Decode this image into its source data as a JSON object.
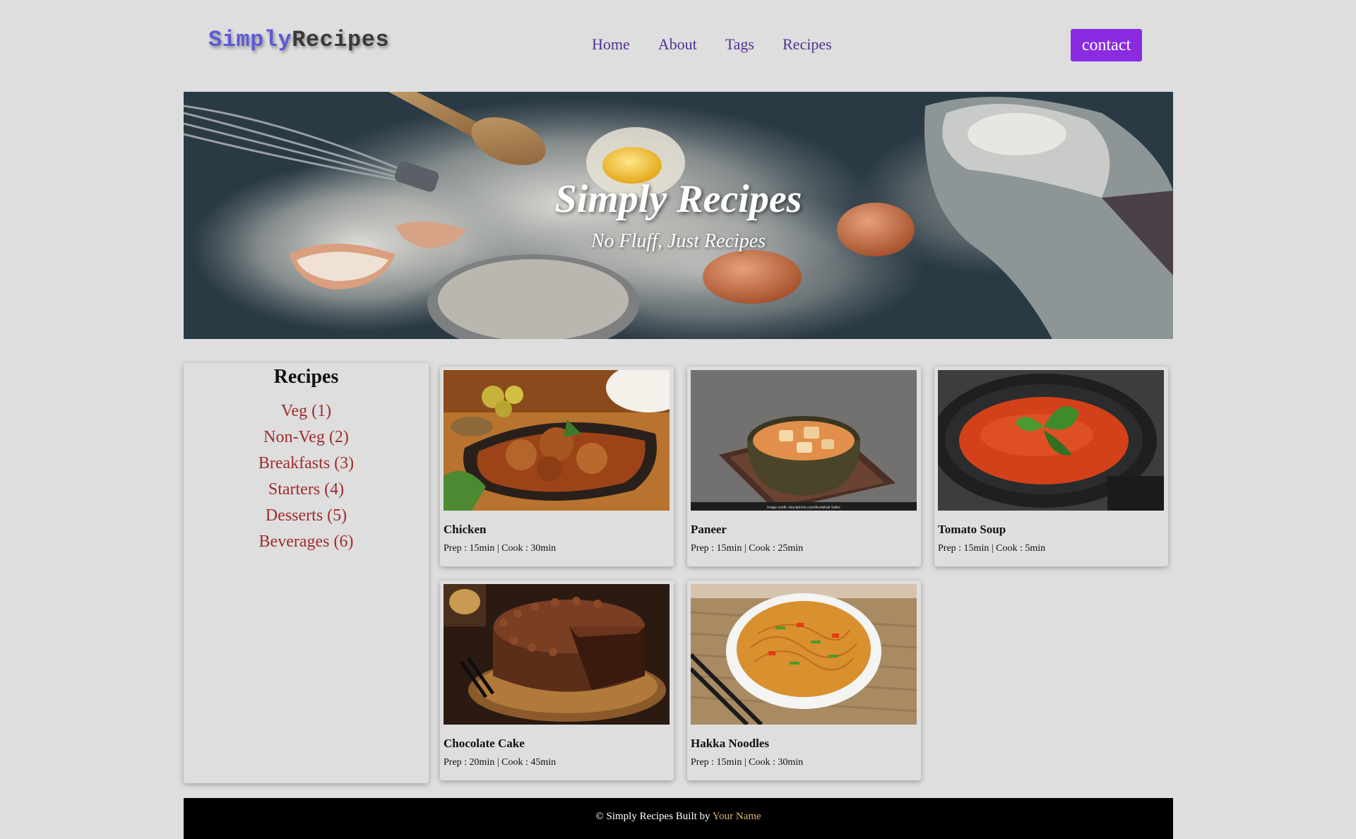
{
  "brand": {
    "part1": "Simply",
    "part2": "Recipes"
  },
  "nav": {
    "home": "Home",
    "about": "About",
    "tags": "Tags",
    "recipes": "Recipes",
    "contact": "contact"
  },
  "hero": {
    "title": "Simply Recipes",
    "subtitle": "No Fluff, Just Recipes"
  },
  "sidebar": {
    "title": "Recipes",
    "items": [
      {
        "label": "Veg (1)"
      },
      {
        "label": "Non-Veg (2)"
      },
      {
        "label": "Breakfasts (3)"
      },
      {
        "label": "Starters (4)"
      },
      {
        "label": "Desserts (5)"
      },
      {
        "label": "Beverages (6)"
      }
    ]
  },
  "recipes": [
    {
      "name": "Chicken",
      "meta": "Prep : 15min | Cook : 30min",
      "image": "chicken-curry-photo"
    },
    {
      "name": "Paneer",
      "meta": "Prep : 15min | Cook : 25min",
      "image": "paneer-curry-photo",
      "credit": "Image credit: istockphoto.com/Arundhati Sathe"
    },
    {
      "name": "Tomato Soup",
      "meta": "Prep : 15min | Cook : 5min",
      "image": "tomato-soup-photo"
    },
    {
      "name": "Chocolate Cake",
      "meta": "Prep : 20min | Cook : 45min",
      "image": "chocolate-cake-photo"
    },
    {
      "name": "Hakka Noodles",
      "meta": "Prep : 15min | Cook : 30min",
      "image": "hakka-noodles-photo"
    }
  ],
  "footer": {
    "text": "© Simply Recipes Built by",
    "author": "Your Name"
  },
  "colors": {
    "background": "#dedede",
    "accent": "#8a2be2",
    "nav_link": "#51318f",
    "sidebar_link": "#a02c2c",
    "footer_link": "#e0b47a"
  }
}
